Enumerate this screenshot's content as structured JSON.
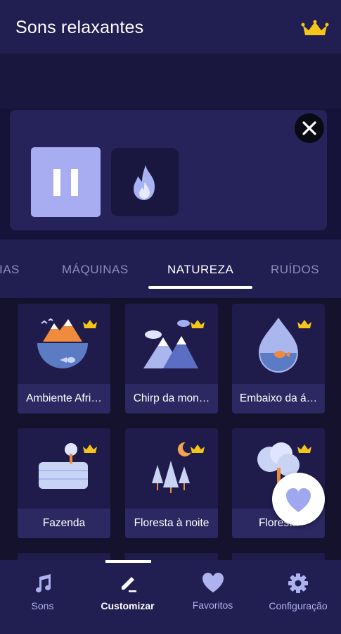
{
  "header": {
    "title": "Sons relaxantes",
    "premium_icon": "crown-icon"
  },
  "player": {
    "close_icon": "close-icon",
    "pause_icon": "pause-icon",
    "active_sound_icon": "fire-icon"
  },
  "tabs": [
    {
      "label": "IAS",
      "active": false
    },
    {
      "label": "MÁQUINAS",
      "active": false
    },
    {
      "label": "NATUREZA",
      "active": true
    },
    {
      "label": "RUÍDOS",
      "active": false
    }
  ],
  "sounds": [
    {
      "label": "Ambiente Africano",
      "display": "Ambiente Afri…",
      "premium": true
    },
    {
      "label": "Chirp da montanha",
      "display": "Chirp da mon…",
      "premium": true
    },
    {
      "label": "Embaixo da água",
      "display": "Embaixo da á…",
      "premium": true
    },
    {
      "label": "Fazenda",
      "display": "Fazenda",
      "premium": true
    },
    {
      "label": "Floresta à noite",
      "display": "Floresta à noite",
      "premium": true
    },
    {
      "label": "Floresta",
      "display": "Floresta",
      "premium": true
    }
  ],
  "fab": {
    "icon": "heart-icon"
  },
  "bottom_nav": [
    {
      "label": "Sons",
      "icon": "music-note-icon",
      "active": false
    },
    {
      "label": "Customizar",
      "icon": "edit-icon",
      "active": true
    },
    {
      "label": "Favoritos",
      "icon": "heart-icon",
      "active": false
    },
    {
      "label": "Configuração",
      "icon": "gear-icon",
      "active": false
    }
  ],
  "colors": {
    "accent": "#a8adf2",
    "header_bg": "#211e52",
    "crown": "#f5c518"
  }
}
